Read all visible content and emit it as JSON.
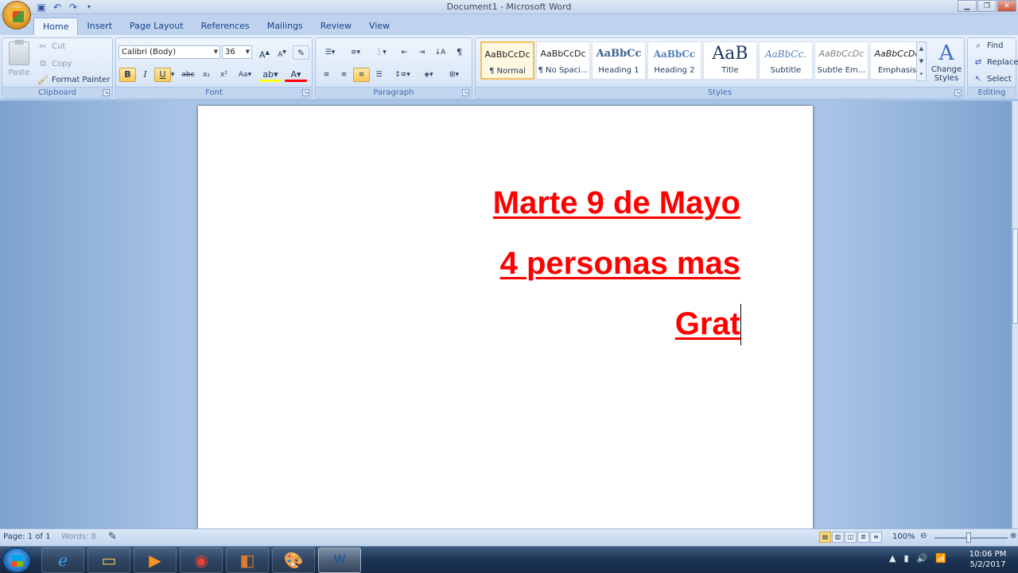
{
  "window": {
    "title": "Document1 - Microsoft Word"
  },
  "qat": {
    "save_icon": "save-icon",
    "undo_icon": "undo-icon",
    "redo_icon": "redo-icon"
  },
  "tabs": [
    {
      "label": "Home",
      "active": true
    },
    {
      "label": "Insert"
    },
    {
      "label": "Page Layout"
    },
    {
      "label": "References"
    },
    {
      "label": "Mailings"
    },
    {
      "label": "Review"
    },
    {
      "label": "View"
    }
  ],
  "clipboard": {
    "group_label": "Clipboard",
    "paste": "Paste",
    "cut": "Cut",
    "copy": "Copy",
    "format_painter": "Format Painter"
  },
  "font": {
    "group_label": "Font",
    "name": "Calibri (Body)",
    "size": "36"
  },
  "paragraph": {
    "group_label": "Paragraph"
  },
  "styles": {
    "group_label": "Styles",
    "items": [
      {
        "preview": "AaBbCcDc",
        "name": "¶ Normal",
        "selected": true
      },
      {
        "preview": "AaBbCcDc",
        "name": "¶ No Spaci..."
      },
      {
        "preview": "AaBbCc",
        "name": "Heading 1"
      },
      {
        "preview": "AaBbCc",
        "name": "Heading 2"
      },
      {
        "preview": "AaB",
        "name": "Title"
      },
      {
        "preview": "AaBbCc.",
        "name": "Subtitle"
      },
      {
        "preview": "AaBbCcDc",
        "name": "Subtle Em..."
      },
      {
        "preview": "AaBbCcDc",
        "name": "Emphasis"
      }
    ],
    "change_styles_1": "Change",
    "change_styles_2": "Styles"
  },
  "editing": {
    "group_label": "Editing",
    "find": "Find",
    "replace": "Replace",
    "select": "Select"
  },
  "document": {
    "lines": [
      "Marte 9 de Mayo",
      "4 personas mas",
      "Grat"
    ],
    "text_color": "#ff0000"
  },
  "status": {
    "page": "Page: 1 of 1",
    "words": "Words: 8",
    "zoom": "100%"
  },
  "taskbar": {
    "time": "10:06 PM",
    "date": "5/2/2017"
  }
}
